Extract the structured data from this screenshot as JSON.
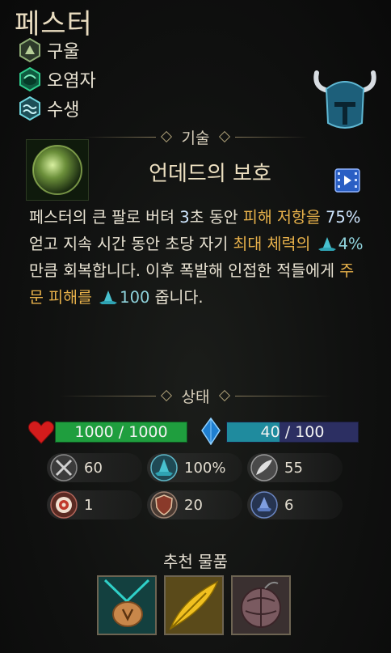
{
  "champion": {
    "name": "페스터"
  },
  "traits": [
    {
      "label": "구울",
      "icon": "ghoul-icon",
      "color": "#6d8f5a"
    },
    {
      "label": "오염자",
      "icon": "defiler-icon",
      "color": "#1f9a6a"
    },
    {
      "label": "수생",
      "icon": "aquatic-icon",
      "color": "#3fa7b0"
    }
  ],
  "skill": {
    "section_label": "기술",
    "name": "언데드의 보호",
    "description": {
      "p1": "페스터의 큰 팔로 버텨 ",
      "p2": "3",
      "p3": "초 동안 ",
      "p4": "피해 저항을",
      "p5": " ",
      "p6": "75%",
      "p7": " 얻고 지속 시간 동안 초당 자기 ",
      "p8": "최대 체력의",
      "p9": "4%",
      "p10": " 만큼 회복합니다. 이후 폭발해 인접한 적들에게 ",
      "p11": "주문 피해를",
      "p12": "100",
      "p13": " 줍니다."
    }
  },
  "status": {
    "section_label": "상태",
    "hp_text": "1000 / 1000",
    "hp_fraction": 1.0,
    "mana_text": "40 / 100",
    "mana_fraction": 0.4,
    "stats": [
      {
        "icon": "attack-damage-icon",
        "value": "60"
      },
      {
        "icon": "ability-power-icon",
        "value": "100%"
      },
      {
        "icon": "attack-speed-icon",
        "value": "55"
      },
      {
        "icon": "range-icon",
        "value": "1"
      },
      {
        "icon": "armor-icon",
        "value": "20"
      },
      {
        "icon": "magic-resist-icon",
        "value": "6"
      }
    ]
  },
  "recommended": {
    "title": "추천 물품",
    "items": [
      {
        "icon": "amulet-item-icon"
      },
      {
        "icon": "feather-item-icon"
      },
      {
        "icon": "orb-item-icon"
      }
    ]
  },
  "colors": {
    "highlight": "#e6b04a",
    "hp": "#1f9e3e",
    "mana": "#1f8b9e",
    "mana_bg": "#2c2f62"
  }
}
